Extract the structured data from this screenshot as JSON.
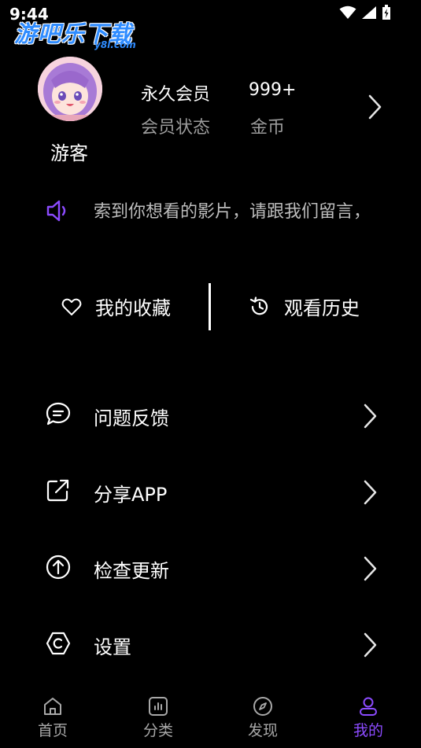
{
  "status_bar": {
    "time": "9:44"
  },
  "watermark": {
    "main": "游吧乐下载",
    "sub": "y8l.com"
  },
  "profile": {
    "username": "游客",
    "membership_value": "永久会员",
    "membership_label": "会员状态",
    "coins_value": "999+",
    "coins_label": "金币"
  },
  "notice": {
    "text": "索到你想看的影片，请跟我们留言，"
  },
  "quick_actions": {
    "favorites": "我的收藏",
    "history": "观看历史"
  },
  "menu": {
    "items": [
      {
        "label": "问题反馈",
        "icon": "feedback-chat-icon"
      },
      {
        "label": "分享APP",
        "icon": "share-icon"
      },
      {
        "label": "检查更新",
        "icon": "update-arrow-icon"
      },
      {
        "label": "设置",
        "icon": "settings-gear-icon"
      }
    ]
  },
  "bottom_nav": {
    "items": [
      {
        "label": "首页",
        "icon": "home-icon",
        "active": false
      },
      {
        "label": "分类",
        "icon": "category-icon",
        "active": false
      },
      {
        "label": "发现",
        "icon": "compass-icon",
        "active": false
      },
      {
        "label": "我的",
        "icon": "profile-icon",
        "active": true
      }
    ]
  },
  "colors": {
    "background": "#000000",
    "accent": "#8c4bff",
    "text_primary": "#ffffff",
    "text_secondary": "#9b9b9b",
    "nav_inactive": "#a8a8a8"
  }
}
